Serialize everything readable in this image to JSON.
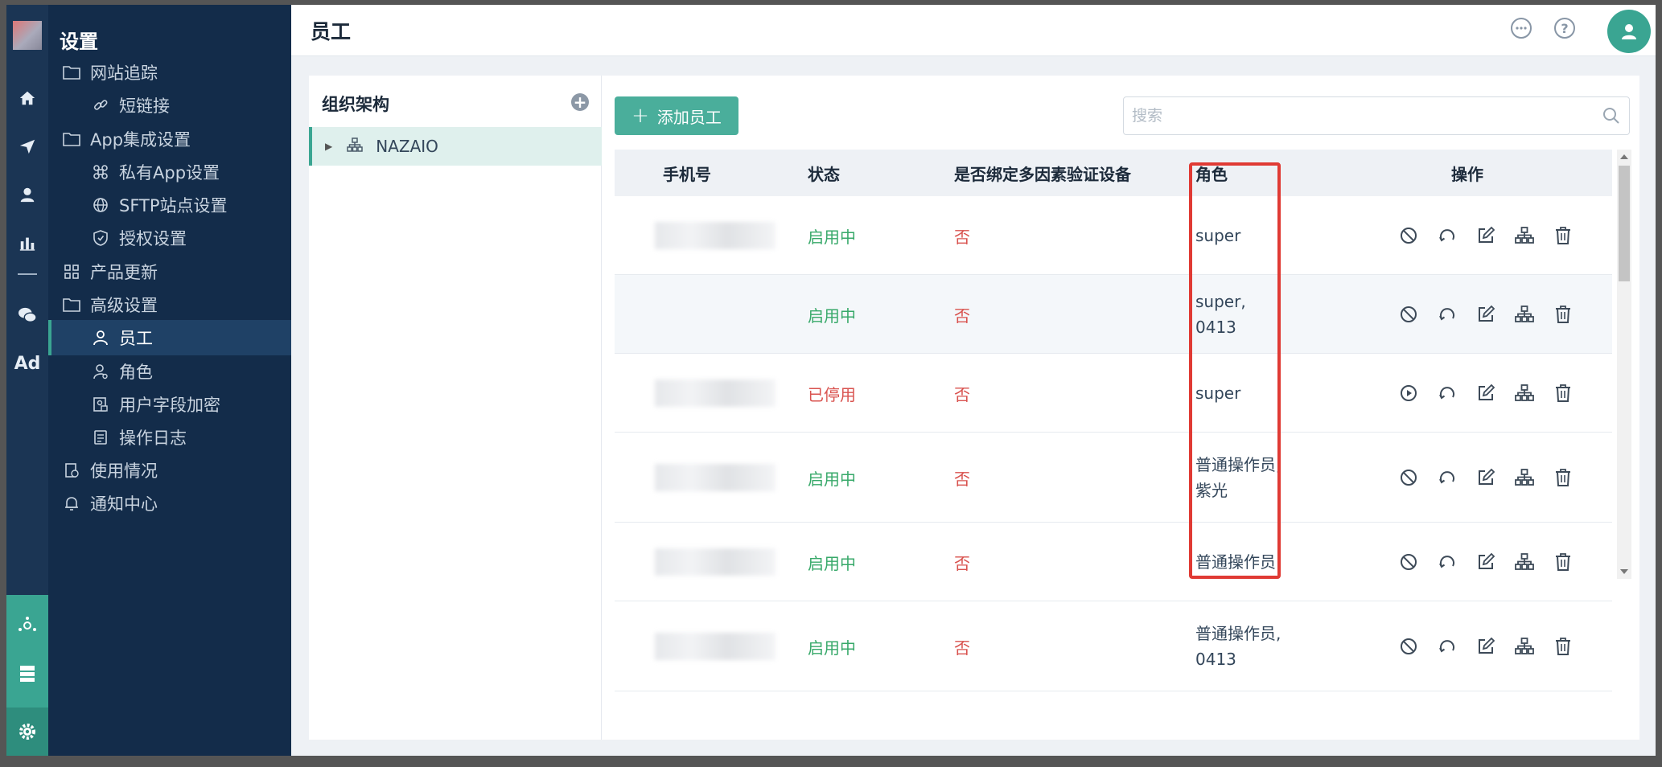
{
  "sidebar": {
    "title": "设置",
    "items": [
      {
        "label": "网站追踪",
        "icon": "folder-icon"
      },
      {
        "label": "短链接",
        "icon": "link-icon"
      },
      {
        "label": "App集成设置",
        "icon": "folder-icon"
      },
      {
        "label": "私有App设置",
        "icon": "command-icon"
      },
      {
        "label": "SFTP站点设置",
        "icon": "globe-icon"
      },
      {
        "label": "授权设置",
        "icon": "shield-icon"
      },
      {
        "label": "产品更新",
        "icon": "grid-icon"
      },
      {
        "label": "高级设置",
        "icon": "folder-icon"
      },
      {
        "label": "员工",
        "icon": "user-icon"
      },
      {
        "label": "角色",
        "icon": "role-icon"
      },
      {
        "label": "用户字段加密",
        "icon": "encrypt-icon"
      },
      {
        "label": "操作日志",
        "icon": "log-icon"
      },
      {
        "label": "使用情况",
        "icon": "usage-icon"
      },
      {
        "label": "通知中心",
        "icon": "bell-icon"
      }
    ]
  },
  "rail": {
    "ad_label": "Ad"
  },
  "header": {
    "title": "员工"
  },
  "org": {
    "title": "组织架构",
    "root_node": "NAZAIO"
  },
  "toolbar": {
    "add_label": "添加员工",
    "search_placeholder": "搜索"
  },
  "table": {
    "columns": [
      "手机号",
      "状态",
      "是否绑定多因素验证设备",
      "角色",
      "操作"
    ],
    "rows": [
      {
        "status": "启用中",
        "mfa": "否",
        "role": "super",
        "enabled": true
      },
      {
        "status": "启用中",
        "mfa": "否",
        "role": "super, 0413",
        "enabled": true
      },
      {
        "status": "已停用",
        "mfa": "否",
        "role": "super",
        "enabled": false
      },
      {
        "status": "启用中",
        "mfa": "否",
        "role": "普通操作员,\n紫光",
        "enabled": true
      },
      {
        "status": "启用中",
        "mfa": "否",
        "role": "普通操作员",
        "enabled": true
      },
      {
        "status": "启用中",
        "mfa": "否",
        "role": "普通操作员,\n0413",
        "enabled": true
      }
    ]
  },
  "colors": {
    "accent": "#3aa592",
    "sidebar": "#132c4a",
    "enabled": "#38a96a",
    "disabled": "#d9534f",
    "highlight": "#e03a34"
  }
}
